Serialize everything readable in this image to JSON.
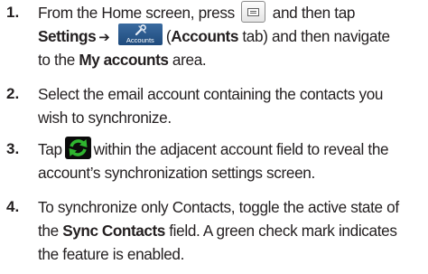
{
  "document": {
    "cut_top_text": "",
    "steps": [
      {
        "number": "1.",
        "segments": {
          "s1": "From the Home screen, press",
          "s2": "and then tap",
          "s3": "Settings",
          "arrow": "➔",
          "s4": "(",
          "s5": "Accounts",
          "s6": " tab) and then navigate",
          "s7": "to the ",
          "s8": "My accounts",
          "s9": " area."
        },
        "icons": {
          "menu_key": "menu-key-icon",
          "accounts_tab": "accounts-tab-icon",
          "accounts_tab_label": "Accounts"
        }
      },
      {
        "number": "2.",
        "segments": {
          "l1": "Select the email account containing the contacts you",
          "l2": "wish to synchronize."
        }
      },
      {
        "number": "3.",
        "segments": {
          "s1": "Tap",
          "s2": "within the adjacent account field to reveal the",
          "l2": "account’s synchronization settings screen."
        },
        "icons": {
          "sync": "sync-icon"
        }
      },
      {
        "number": "4.",
        "segments": {
          "l1": "To synchronize only Contacts, toggle the active state of",
          "l2a": "the ",
          "l2b": "Sync Contacts",
          "l2c": " field. A green check mark indicates",
          "l3": "the feature is enabled."
        }
      }
    ]
  },
  "colors": {
    "text": "#231f20",
    "accounts_tab_bg": "#2a5a8e",
    "sync_green": "#2fb52f",
    "sync_bg": "#0b0b0b"
  }
}
